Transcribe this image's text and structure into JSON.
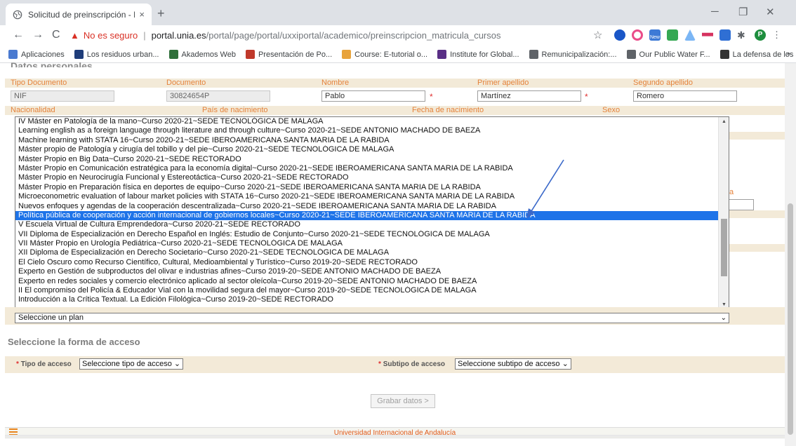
{
  "browser": {
    "tab_title": "Solicitud de preinscripción - Port",
    "tab_close": "×",
    "new_tab": "+",
    "address": {
      "warning": "No es seguro",
      "separator": "|",
      "host": "portal.unia.es",
      "path": "/portal/page/portal/uxxiportal/academico/preinscripcion_matricula_cursos"
    },
    "bookmarks": [
      {
        "label": "Aplicaciones",
        "color": "#4a7ad0"
      },
      {
        "label": "Los residuos urban...",
        "color": "#1f3d7a"
      },
      {
        "label": "Akademos Web",
        "color": "#2f6f3a"
      },
      {
        "label": "Presentación de Po...",
        "color": "#c0392b"
      },
      {
        "label": "Course: E-tutorial o...",
        "color": "#e8a33c"
      },
      {
        "label": "Institute for Global...",
        "color": "#5a2f86"
      },
      {
        "label": "Remunicipalización:...",
        "color": "#5f6368"
      },
      {
        "label": "Our Public Water F...",
        "color": "#5f6368"
      },
      {
        "label": "La defensa de los s...",
        "color": "#333333"
      }
    ],
    "bookmarks_more": "»",
    "profile_initial": "P",
    "ext_badge": "New"
  },
  "form": {
    "section_title": "Datos personales",
    "row1_labels": {
      "tipo_documento": "Tipo Documento",
      "documento": "Documento",
      "nombre": "Nombre",
      "primer_apellido": "Primer apellido",
      "segundo_apellido": "Segundo apellido"
    },
    "row1_values": {
      "tipo_documento": "NIF",
      "documento": "30824654P",
      "nombre": "Pablo",
      "primer_apellido": "Martínez",
      "segundo_apellido": "Romero"
    },
    "required_mark": "*",
    "row2_labels": {
      "nacionalidad": "Nacionalidad",
      "pais_nacimiento": "País de nacimiento",
      "fecha_nacimiento": "Fecha de nacimiento",
      "sexo": "Sexo"
    },
    "side_label": "a"
  },
  "course_list": {
    "selected_index": 10,
    "options": [
      "IV Máster en Patología de la mano~Curso 2020-21~SEDE TECNOLÓGICA DE MALAGA",
      "Learning english as a foreign language through literature and through culture~Curso 2020-21~SEDE ANTONIO MACHADO DE BAEZA",
      "Machine learning with STATA 16~Curso 2020-21~SEDE IBEROAMERICANA SANTA MARIA DE LA RABIDA",
      "Máster propio de Patología y cirugía del tobillo y del pie~Curso 2020-21~SEDE TECNOLÓGICA DE MALAGA",
      "Máster Propio en Big Data~Curso 2020-21~SEDE RECTORADO",
      "Máster Propio en Comunicación estratégica para la economía digital~Curso 2020-21~SEDE IBEROAMERICANA SANTA MARIA DE LA RABIDA",
      "Máster Propio en Neurocirugía Funcional y Estereotáctica~Curso 2020-21~SEDE RECTORADO",
      "Máster Propio en Preparación física en deportes de equipo~Curso 2020-21~SEDE IBEROAMERICANA SANTA MARIA DE LA RABIDA",
      "Microeconometric evaluation of labour market policies with STATA 16~Curso 2020-21~SEDE IBEROAMERICANA SANTA MARIA DE LA RABIDA",
      "Nuevos enfoques y agendas de la cooperación descentralizada~Curso 2020-21~SEDE IBEROAMERICANA SANTA MARIA DE LA RABIDA",
      "Política pública de cooperación y acción internacional de gobiernos locales~Curso 2020-21~SEDE IBEROAMERICANA SANTA MARIA DE LA RABIDA",
      "V Escuela Virtual de Cultura Emprendedora~Curso 2020-21~SEDE RECTORADO",
      "VII Diploma de Especialización en Derecho Español en Inglés: Estudio de Conjunto~Curso 2020-21~SEDE TECNOLÓGICA DE MALAGA",
      "VII Máster Propio en Urología Pediátrica~Curso 2020-21~SEDE TECNOLÓGICA DE MALAGA",
      "XII Diploma de Especialización en Derecho Societario~Curso 2020-21~SEDE TECNOLÓGICA DE MALAGA",
      "El Cielo Oscuro como Recurso Científico, Cultural, Medioambiental y Turístico~Curso 2019-20~SEDE RECTORADO",
      "Experto en Gestión de subproductos del olivar e industrias afines~Curso 2019-20~SEDE ANTONIO MACHADO DE BAEZA",
      "Experto en redes sociales y comercio electrónico aplicado al sector oleícola~Curso 2019-20~SEDE ANTONIO MACHADO DE BAEZA",
      "II El compromiso del Policía & Educador Vial con la movilidad segura del mayor~Curso 2019-20~SEDE TECNOLÓGICA DE MALAGA",
      "Introducción a la Crítica Textual. La Edición Filológica~Curso 2019-20~SEDE RECTORADO"
    ]
  },
  "plan": {
    "placeholder": "Seleccione un plan"
  },
  "access": {
    "title": "Seleccione la forma de acceso",
    "tipo_label": "Tipo de acceso",
    "tipo_value": "Seleccione tipo de acceso",
    "subtipo_label": "Subtipo de acceso",
    "subtipo_value": "Seleccione subtipo de acceso"
  },
  "actions": {
    "grabar": "Grabar datos >"
  },
  "footer": {
    "text": "Universidad Internacional de Andalucía"
  },
  "colors": {
    "label_orange": "#e4823a",
    "band_beige": "#f3ead8",
    "selection_blue": "#1e73e8",
    "arrow_blue": "#3a68c9",
    "footer_text": "#e05a1a"
  }
}
